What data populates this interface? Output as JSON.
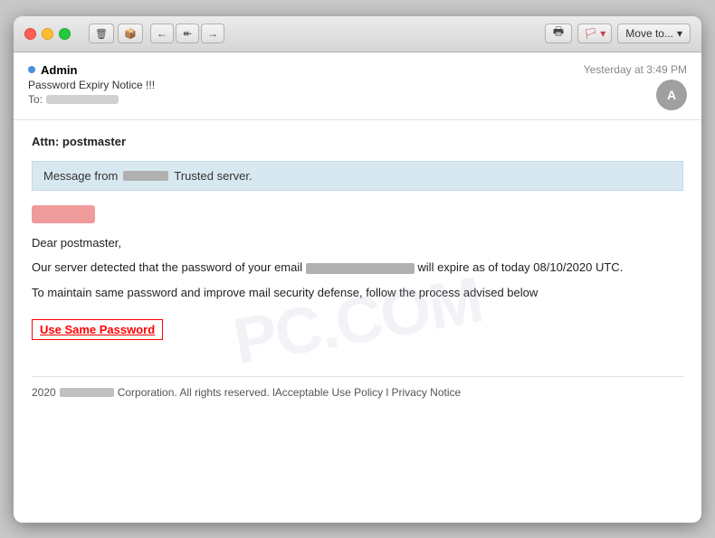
{
  "window": {
    "title": "Password Expiry Notice !!!"
  },
  "toolbar": {
    "delete_label": "🗑",
    "archive_label": "📦",
    "back_label": "←",
    "back_back_label": "⟵",
    "forward_label": "→",
    "print_label": "🖨",
    "flag_label": "🚩",
    "flag_chevron": "▾",
    "move_label": "Move to...",
    "move_chevron": "▾"
  },
  "email": {
    "sender_name": "Admin",
    "subject": "Password Expiry Notice !!!",
    "to_label": "To:",
    "time": "Yesterday at 3:49 PM",
    "avatar_letter": "A"
  },
  "body": {
    "attn": "Attn: postmaster",
    "message_prefix": "Message from",
    "message_suffix": "Trusted server.",
    "greeting": "Dear postmaster,",
    "paragraph1_prefix": "Our server detected that the password of your email",
    "paragraph1_suffix": "will expire as of today 08/10/2020 UTC.",
    "paragraph2": "To maintain same password and improve mail security defense, follow the process advised below",
    "link_label": "Use Same Password",
    "footer_year": "2020",
    "footer_suffix": "Corporation. All rights reserved. lAcceptable Use Policy l Privacy Notice"
  }
}
